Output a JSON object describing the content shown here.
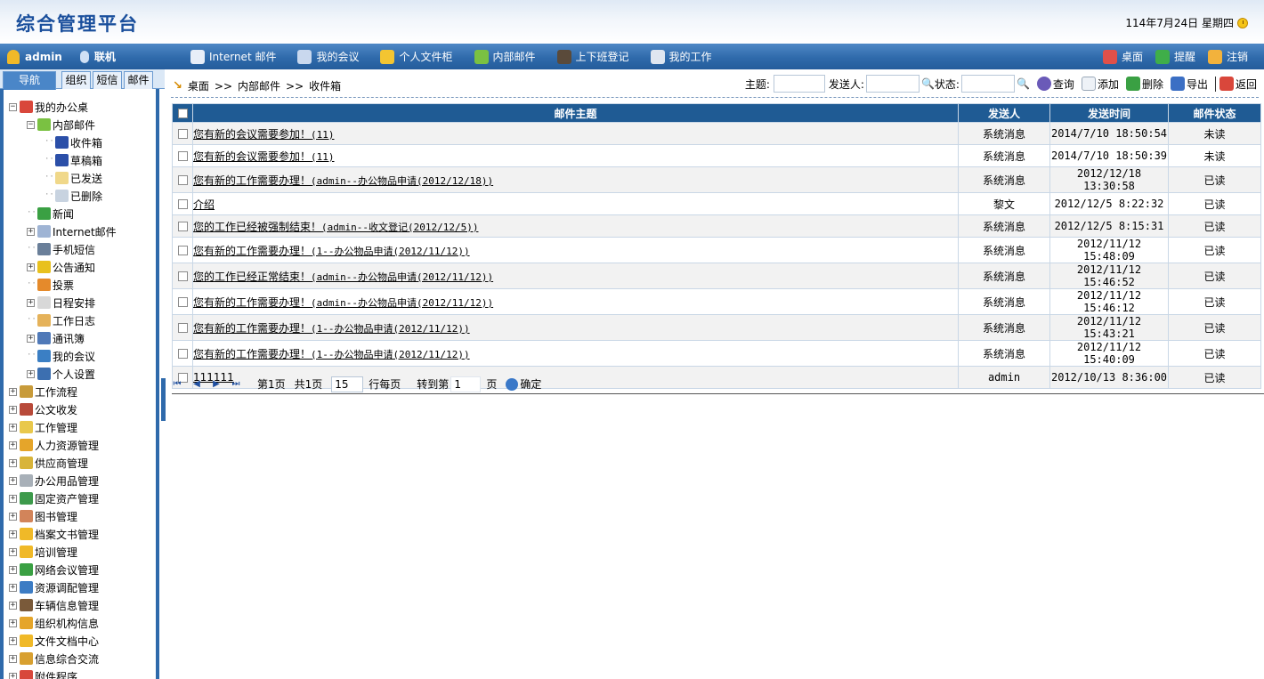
{
  "banner": {
    "title": "综合管理平台",
    "date": "114年7月24日 星期四"
  },
  "navbar": {
    "user": "admin",
    "status": "联机",
    "items": [
      {
        "label": "Internet 邮件",
        "icon": "internet-mail-icon",
        "color": "#e8eef8"
      },
      {
        "label": "我的会议",
        "icon": "meeting-icon",
        "color": "#c9d8ee"
      },
      {
        "label": "个人文件柜",
        "icon": "folder-icon",
        "color": "#f3c531"
      },
      {
        "label": "内部邮件",
        "icon": "mail-icon",
        "color": "#7ac142"
      },
      {
        "label": "上下班登记",
        "icon": "attendance-icon",
        "color": "#5a4a3a"
      },
      {
        "label": "我的工作",
        "icon": "work-icon",
        "color": "#dfe6f0"
      }
    ],
    "right": [
      {
        "label": "桌面",
        "icon": "desktop-icon",
        "color": "#e0504a"
      },
      {
        "label": "提醒",
        "icon": "reminder-icon",
        "color": "#3fae49"
      },
      {
        "label": "注销",
        "icon": "logout-icon",
        "color": "#f2b23c"
      }
    ]
  },
  "sidebar": {
    "tabs": [
      "导航",
      "组织",
      "短信",
      "邮件"
    ],
    "tree": [
      {
        "label": "我的办公桌",
        "level": 0,
        "toggle": "−",
        "icon": "desk-icon",
        "color": "#d9473b"
      },
      {
        "label": "内部邮件",
        "level": 1,
        "toggle": "−",
        "icon": "mail-icon",
        "color": "#7ac142"
      },
      {
        "label": "收件箱",
        "level": 2,
        "toggle": "",
        "icon": "inbox-icon",
        "color": "#2b4fa8"
      },
      {
        "label": "草稿箱",
        "level": 2,
        "toggle": "",
        "icon": "drafts-icon",
        "color": "#2b4fa8"
      },
      {
        "label": "已发送",
        "level": 2,
        "toggle": "",
        "icon": "sent-icon",
        "color": "#f0d88a"
      },
      {
        "label": "已删除",
        "level": 2,
        "toggle": "",
        "icon": "trash-icon",
        "color": "#c8d3e0"
      },
      {
        "label": "新闻",
        "level": 1,
        "toggle": "",
        "icon": "news-icon",
        "color": "#3aa043"
      },
      {
        "label": "Internet邮件",
        "level": 1,
        "toggle": "+",
        "icon": "internet-mail-icon",
        "color": "#9fb4d4"
      },
      {
        "label": "手机短信",
        "level": 1,
        "toggle": "",
        "icon": "phone-icon",
        "color": "#6a7f99"
      },
      {
        "label": "公告通知",
        "level": 1,
        "toggle": "+",
        "icon": "notice-icon",
        "color": "#e8c11e"
      },
      {
        "label": "投票",
        "level": 1,
        "toggle": "",
        "icon": "vote-icon",
        "color": "#e58a2b"
      },
      {
        "label": "日程安排",
        "level": 1,
        "toggle": "+",
        "icon": "calendar-icon",
        "color": "#d8d8d8"
      },
      {
        "label": "工作日志",
        "level": 1,
        "toggle": "",
        "icon": "log-icon",
        "color": "#e5b25a"
      },
      {
        "label": "通讯簿",
        "level": 1,
        "toggle": "+",
        "icon": "contacts-icon",
        "color": "#4f79b8"
      },
      {
        "label": "我的会议",
        "level": 1,
        "toggle": "",
        "icon": "meeting-icon",
        "color": "#3b7fc4"
      },
      {
        "label": "个人设置",
        "level": 1,
        "toggle": "+",
        "icon": "settings-icon",
        "color": "#3c6fb0"
      },
      {
        "label": "工作流程",
        "level": 0,
        "toggle": "+",
        "icon": "workflow-icon",
        "color": "#c89b3a"
      },
      {
        "label": "公文收发",
        "level": 0,
        "toggle": "+",
        "icon": "document-icon",
        "color": "#b84a3a"
      },
      {
        "label": "工作管理",
        "level": 0,
        "toggle": "+",
        "icon": "work-manage-icon",
        "color": "#e9c84c"
      },
      {
        "label": "人力资源管理",
        "level": 0,
        "toggle": "+",
        "icon": "hr-icon",
        "color": "#e5a52a"
      },
      {
        "label": "供应商管理",
        "level": 0,
        "toggle": "+",
        "icon": "supplier-icon",
        "color": "#d8b43a"
      },
      {
        "label": "办公用品管理",
        "level": 0,
        "toggle": "+",
        "icon": "office-supplies-icon",
        "color": "#a8b0b8"
      },
      {
        "label": "固定资产管理",
        "level": 0,
        "toggle": "+",
        "icon": "assets-icon",
        "color": "#3d9a4b"
      },
      {
        "label": "图书管理",
        "level": 0,
        "toggle": "+",
        "icon": "book-icon",
        "color": "#d2845a"
      },
      {
        "label": "档案文书管理",
        "level": 0,
        "toggle": "+",
        "icon": "archive-icon",
        "color": "#f0b928"
      },
      {
        "label": "培训管理",
        "level": 0,
        "toggle": "+",
        "icon": "training-icon",
        "color": "#f0b928"
      },
      {
        "label": "网络会议管理",
        "level": 0,
        "toggle": "+",
        "icon": "web-meeting-icon",
        "color": "#3aa043"
      },
      {
        "label": "资源调配管理",
        "level": 0,
        "toggle": "+",
        "icon": "resource-icon",
        "color": "#3c7cc4"
      },
      {
        "label": "车辆信息管理",
        "level": 0,
        "toggle": "+",
        "icon": "vehicle-icon",
        "color": "#7a5a3a"
      },
      {
        "label": "组织机构信息",
        "level": 0,
        "toggle": "+",
        "icon": "org-icon",
        "color": "#e5a52a"
      },
      {
        "label": "文件文档中心",
        "level": 0,
        "toggle": "+",
        "icon": "file-center-icon",
        "color": "#f0b928"
      },
      {
        "label": "信息综合交流",
        "level": 0,
        "toggle": "+",
        "icon": "exchange-icon",
        "color": "#d8a030"
      },
      {
        "label": "附件程序",
        "level": 0,
        "toggle": "+",
        "icon": "attachment-icon",
        "color": "#d8473b"
      }
    ]
  },
  "breadcrumb": [
    "桌面",
    ">>",
    "内部邮件",
    ">>",
    "收件箱"
  ],
  "toolbar": {
    "subject_label": "主题:",
    "sender_label": "发送人:",
    "status_label": "状态:",
    "search": "查询",
    "add": "添加",
    "delete": "删除",
    "export": "导出",
    "back": "返回"
  },
  "table": {
    "headers": [
      "邮件主题",
      "发送人",
      "发送时间",
      "邮件状态"
    ],
    "rows": [
      {
        "title": "您有新的会议需要参加！",
        "detail": "(11)",
        "sender": "系统消息",
        "time": "2014/7/10 18:50:54",
        "status": "未读"
      },
      {
        "title": "您有新的会议需要参加！",
        "detail": "(11)",
        "sender": "系统消息",
        "time": "2014/7/10 18:50:39",
        "status": "未读"
      },
      {
        "title": "您有新的工作需要办理！",
        "detail": "(admin--办公物品申请(2012/12/18))",
        "sender": "系统消息",
        "time": "2012/12/18 13:30:58",
        "status": "已读"
      },
      {
        "title": "介绍",
        "detail": "",
        "sender": "黎文",
        "time": "2012/12/5 8:22:32",
        "status": "已读"
      },
      {
        "title": "您的工作已经被强制结束！",
        "detail": "(admin--收文登记(2012/12/5))",
        "sender": "系统消息",
        "time": "2012/12/5 8:15:31",
        "status": "已读"
      },
      {
        "title": "您有新的工作需要办理！",
        "detail": "(1--办公物品申请(2012/11/12))",
        "sender": "系统消息",
        "time": "2012/11/12 15:48:09",
        "status": "已读"
      },
      {
        "title": "您的工作已经正常结束！",
        "detail": "(admin--办公物品申请(2012/11/12))",
        "sender": "系统消息",
        "time": "2012/11/12 15:46:52",
        "status": "已读"
      },
      {
        "title": "您有新的工作需要办理！",
        "detail": "(admin--办公物品申请(2012/11/12))",
        "sender": "系统消息",
        "time": "2012/11/12 15:46:12",
        "status": "已读"
      },
      {
        "title": "您有新的工作需要办理！",
        "detail": "(1--办公物品申请(2012/11/12))",
        "sender": "系统消息",
        "time": "2012/11/12 15:43:21",
        "status": "已读"
      },
      {
        "title": "您有新的工作需要办理！",
        "detail": "(1--办公物品申请(2012/11/12))",
        "sender": "系统消息",
        "time": "2012/11/12 15:40:09",
        "status": "已读"
      },
      {
        "title": "111111",
        "detail": "",
        "sender": "admin",
        "time": "2012/10/13 8:36:00",
        "status": "已读"
      }
    ]
  },
  "pager": {
    "page_text": "第1页",
    "total_text": "共1页",
    "per_page": "15",
    "per_page_label": "行每页",
    "goto_label": "转到第",
    "goto_value": "1",
    "page_suffix": "页",
    "confirm": "确定"
  }
}
